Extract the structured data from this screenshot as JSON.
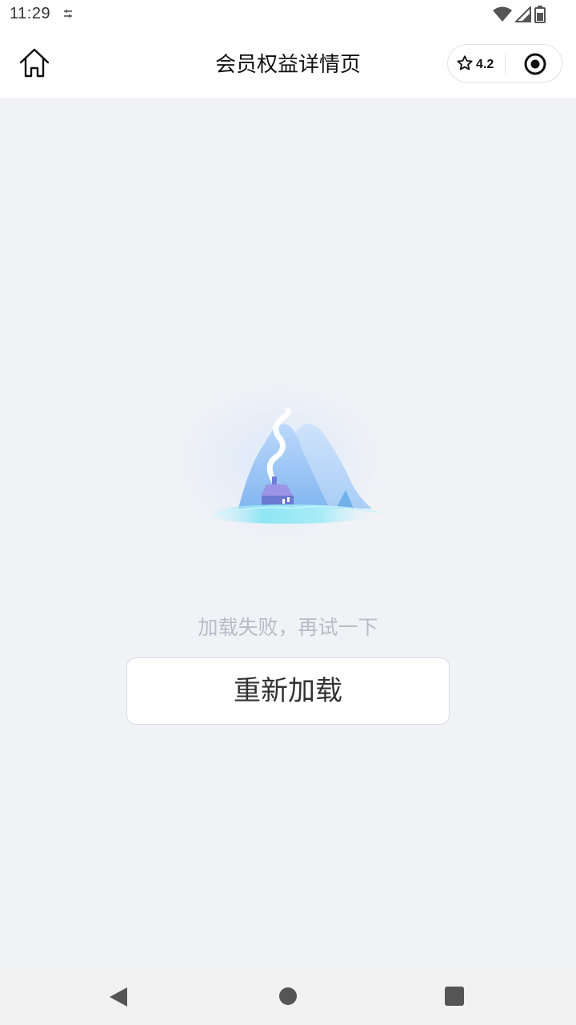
{
  "status_bar": {
    "time": "11:29",
    "notification_icon": "sliders-icon",
    "icons": [
      "wifi-icon",
      "cell-signal-icon",
      "battery-icon"
    ]
  },
  "nav": {
    "title": "会员权益详情页",
    "home_icon": "home-icon",
    "rating": "4.2",
    "rating_icon": "star-outline-icon",
    "record_icon": "record-target-icon"
  },
  "empty_state": {
    "illustration": "house-in-snowy-mountains-illustration",
    "message": "加载失败，再试一下",
    "reload_label": "重新加载"
  },
  "system_nav": {
    "back_icon": "back-triangle-icon",
    "home_icon": "home-circle-icon",
    "recents_icon": "recents-square-icon"
  },
  "colors": {
    "page_background": "#f1f2f6",
    "header_background": "#ffffff",
    "message_text": "#b8bcc6",
    "button_border": "#d9dbe0"
  }
}
